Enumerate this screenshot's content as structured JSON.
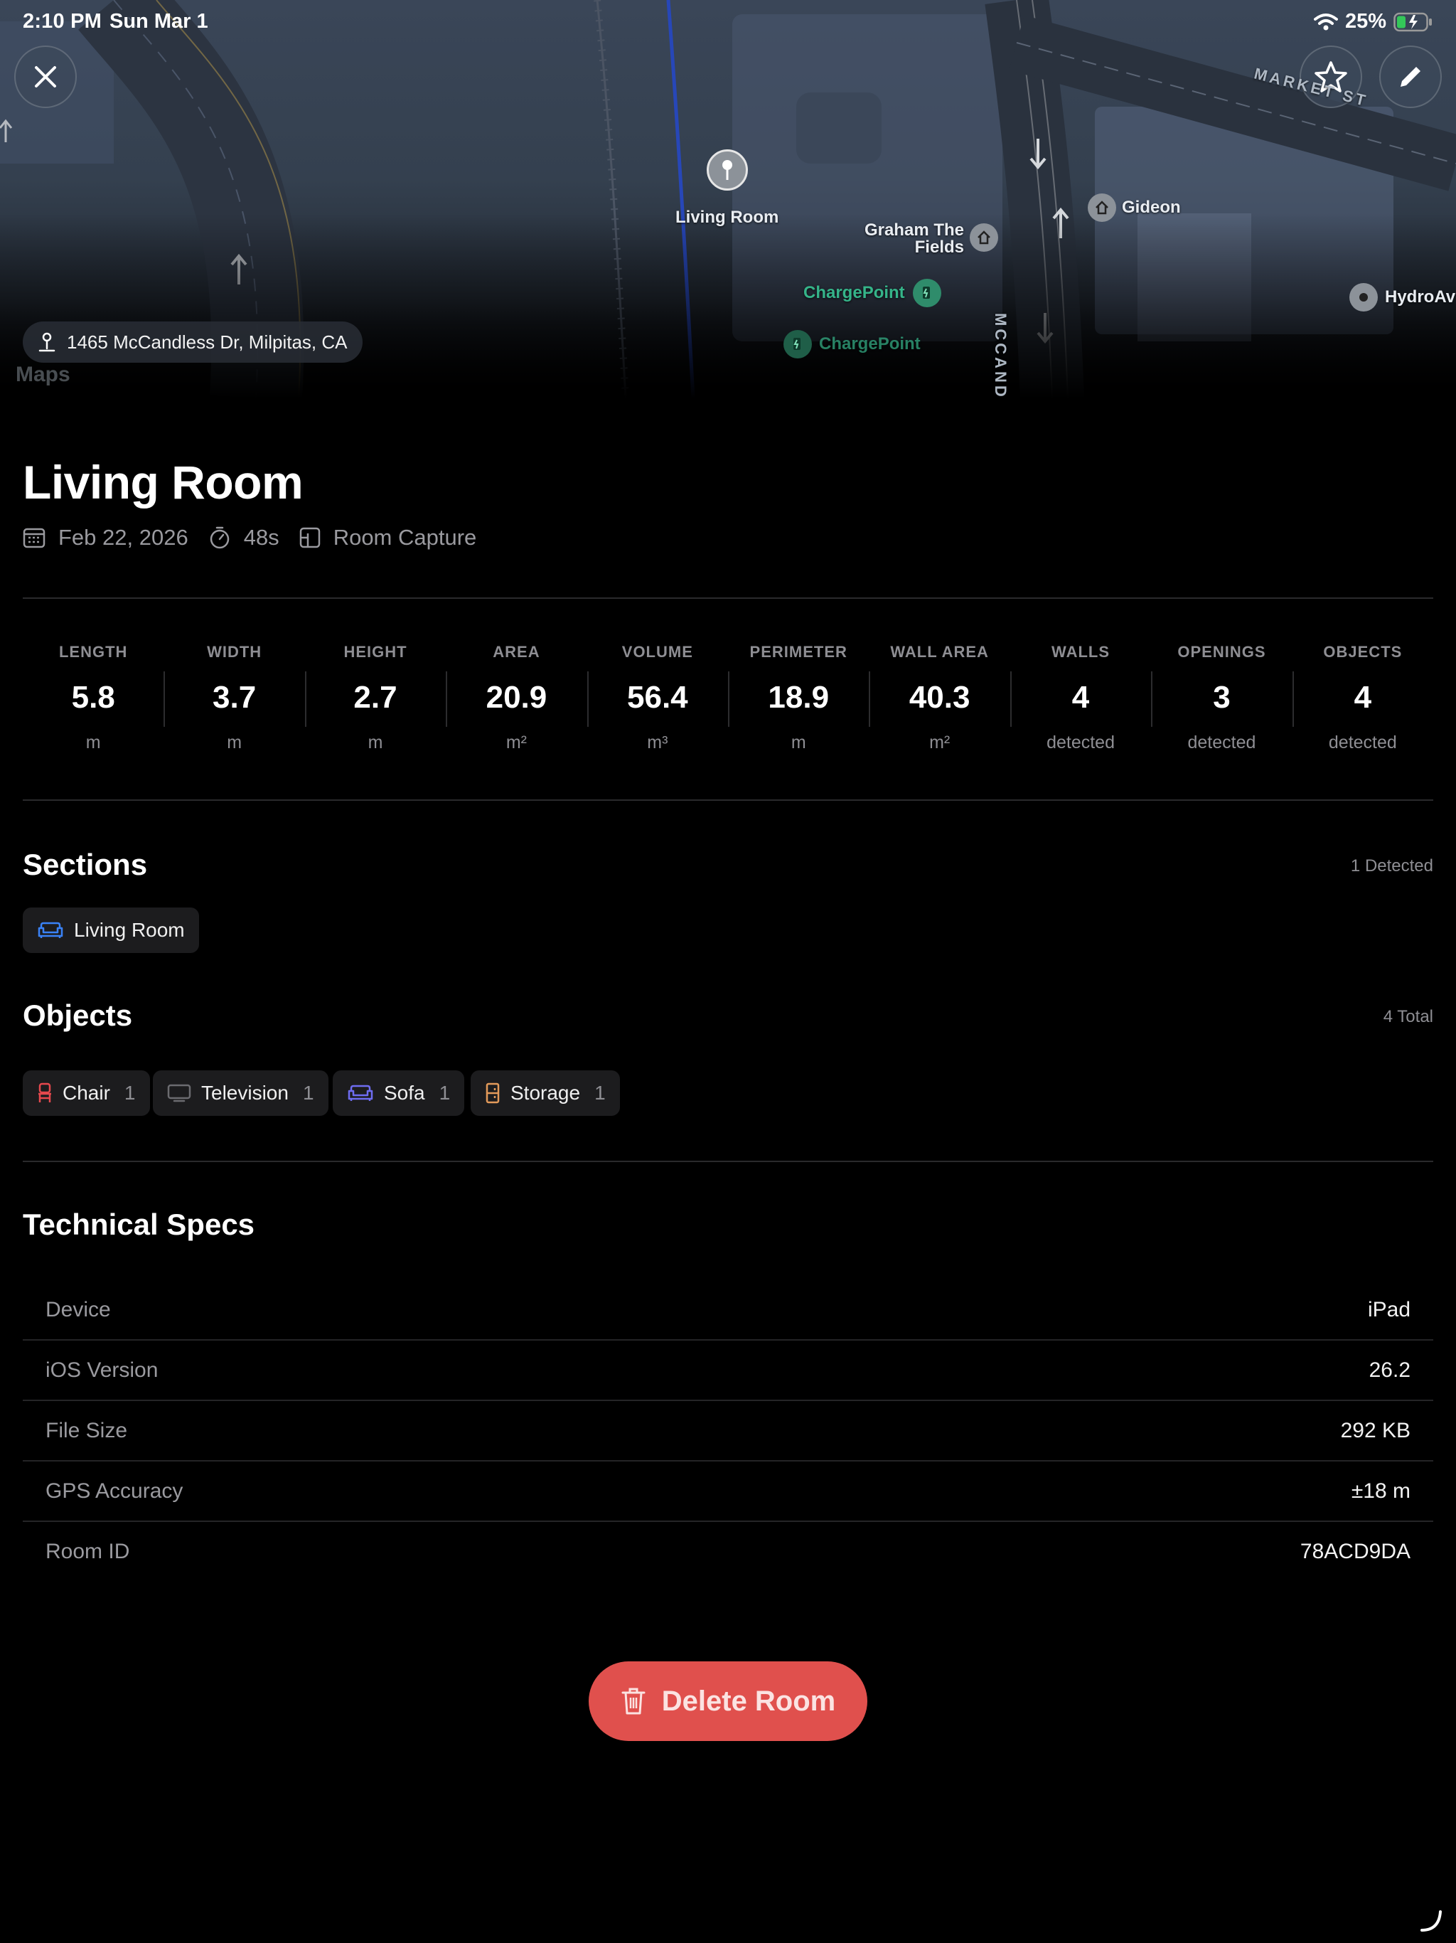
{
  "status_bar": {
    "time": "2:10 PM",
    "date": "Sun Mar 1",
    "battery": "25%"
  },
  "map": {
    "pin_label": "Living Room",
    "places": [
      "Graham The",
      "Fields",
      "ChargePoint",
      "ChargePoint",
      "Gideon",
      "HydroAv"
    ],
    "streets": [
      "MARKET ST",
      "MCCANDLESS"
    ],
    "address": "1465 McCandless Dr, Milpitas, CA",
    "logo": "Maps",
    "colors": {
      "charge": "#35b489",
      "poi": "#8c9299"
    }
  },
  "room": {
    "title": "Living Room",
    "date": "Feb 22, 2026",
    "duration": "48s",
    "type": "Room Capture"
  },
  "stats": [
    {
      "label": "LENGTH",
      "value": "5.8",
      "unit": "m"
    },
    {
      "label": "WIDTH",
      "value": "3.7",
      "unit": "m"
    },
    {
      "label": "HEIGHT",
      "value": "2.7",
      "unit": "m"
    },
    {
      "label": "AREA",
      "value": "20.9",
      "unit": "m²"
    },
    {
      "label": "VOLUME",
      "value": "56.4",
      "unit": "m³"
    },
    {
      "label": "PERIMETER",
      "value": "18.9",
      "unit": "m"
    },
    {
      "label": "WALL AREA",
      "value": "40.3",
      "unit": "m²"
    },
    {
      "label": "WALLS",
      "value": "4",
      "unit": "detected"
    },
    {
      "label": "OPENINGS",
      "value": "3",
      "unit": "detected"
    },
    {
      "label": "OBJECTS",
      "value": "4",
      "unit": "detected"
    }
  ],
  "sections": {
    "heading": "Sections",
    "count": "1 Detected",
    "items": [
      {
        "label": "Living Room",
        "icon": "sofa-icon",
        "color": "#3a82f7"
      }
    ]
  },
  "objects": {
    "heading": "Objects",
    "count": "4 Total",
    "items": [
      {
        "label": "Chair",
        "count": "1",
        "icon": "chair-icon",
        "color": "#e5484d"
      },
      {
        "label": "Television",
        "count": "1",
        "icon": "tv-icon",
        "color": "#6b6b70"
      },
      {
        "label": "Sofa",
        "count": "1",
        "icon": "sofa-icon",
        "color": "#6e6cf0"
      },
      {
        "label": "Storage",
        "count": "1",
        "icon": "storage-icon",
        "color": "#e39a5a"
      }
    ]
  },
  "tech_specs": {
    "heading": "Technical Specs",
    "rows": [
      {
        "key": "Device",
        "value": "iPad"
      },
      {
        "key": "iOS Version",
        "value": "26.2"
      },
      {
        "key": "File Size",
        "value": "292 KB"
      },
      {
        "key": "GPS Accuracy",
        "value": "±18 m"
      },
      {
        "key": "Room ID",
        "value": "78ACD9DA"
      }
    ]
  },
  "actions": {
    "delete_label": "Delete Room",
    "delete_color": "#e0504d"
  }
}
